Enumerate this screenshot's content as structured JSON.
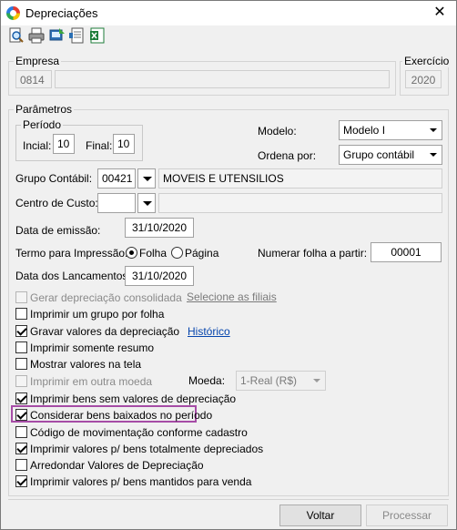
{
  "window": {
    "title": "Depreciações",
    "close_glyph": "✕"
  },
  "toolbar": {
    "icons": [
      "preview-icon",
      "print-icon",
      "export-icon",
      "page-setup-icon",
      "excel-icon"
    ]
  },
  "empresa": {
    "legend": "Empresa",
    "code": "0814",
    "name": ""
  },
  "exercicio": {
    "legend": "Exercício",
    "value": "2020"
  },
  "parametros": {
    "legend": "Parâmetros",
    "periodo": {
      "legend": "Período",
      "inicial_label": "Incial:",
      "inicial_value": "10",
      "final_label": "Final:",
      "final_value": "10"
    },
    "modelo": {
      "label": "Modelo:",
      "value": "Modelo I"
    },
    "ordena": {
      "label": "Ordena por:",
      "value": "Grupo contábil"
    },
    "grupo": {
      "label": "Grupo Contábil:",
      "code": "00421",
      "name": "MOVEIS E UTENSILIOS"
    },
    "centro": {
      "label": "Centro de Custo:",
      "code": "",
      "name": ""
    },
    "emissao": {
      "label": "Data de emissão:",
      "value": "31/10/2020"
    },
    "termo": {
      "label": "Termo para Impressão:",
      "opt1": "Folha",
      "opt2": "Página",
      "selected": "Folha"
    },
    "numerar": {
      "label": "Numerar folha a partir:",
      "value": "00001"
    },
    "lancamentos": {
      "label": "Data dos Lancamentos:",
      "value": "31/10/2020"
    },
    "checks": [
      {
        "label": "Gerar depreciação consolidada",
        "checked": false,
        "enabled": false
      },
      {
        "label": "Imprimir um grupo por folha",
        "checked": false,
        "enabled": true
      },
      {
        "label": "Gravar valores da depreciação",
        "checked": true,
        "enabled": true
      },
      {
        "label": "Imprimir somente resumo",
        "checked": false,
        "enabled": true
      },
      {
        "label": "Mostrar valores na tela",
        "checked": false,
        "enabled": true
      },
      {
        "label": "Imprimir em outra moeda",
        "checked": false,
        "enabled": false
      },
      {
        "label": "Imprimir bens sem valores de depreciação",
        "checked": true,
        "enabled": true
      },
      {
        "label": "Considerar bens baixados no período",
        "checked": true,
        "enabled": true
      },
      {
        "label": "Código de movimentação conforme cadastro",
        "checked": false,
        "enabled": true
      },
      {
        "label": "Imprimir valores p/ bens totalmente depreciados",
        "checked": true,
        "enabled": true
      },
      {
        "label": "Arredondar Valores de Depreciação",
        "checked": false,
        "enabled": true
      },
      {
        "label": "Imprimir valores p/ bens mantidos para venda",
        "checked": true,
        "enabled": true
      }
    ],
    "links": {
      "filiais": "Selecione as filiais",
      "historico": "Histórico"
    },
    "moeda": {
      "label": "Moeda:",
      "value": "1-Real (R$)"
    }
  },
  "buttons": {
    "voltar": "Voltar",
    "processar": "Processar"
  },
  "colors": {
    "highlight": "#a64ca6",
    "link": "#0645ad"
  }
}
